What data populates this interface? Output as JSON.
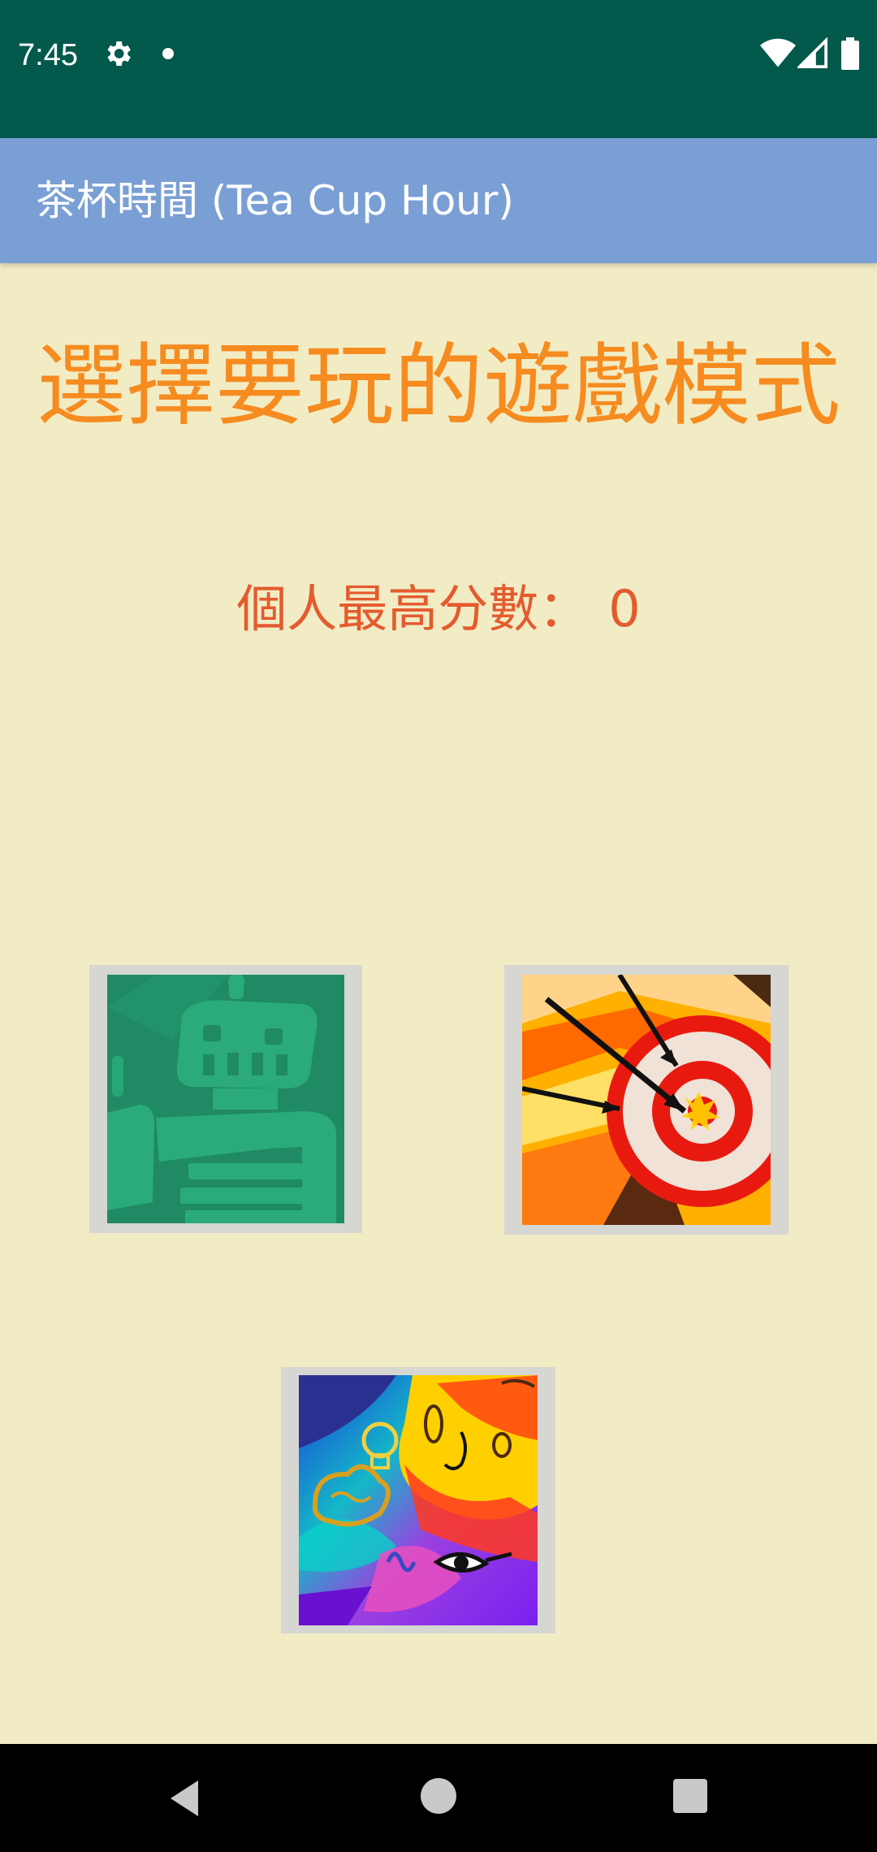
{
  "status_bar": {
    "time": "7:45",
    "icons": [
      "settings-icon",
      "notification-dot-icon",
      "wifi-icon",
      "signal-icon",
      "battery-icon"
    ]
  },
  "app_bar": {
    "title": "茶杯時間 (Tea Cup Hour)",
    "color": "#7a9fd4"
  },
  "main": {
    "heading": "選擇要玩的遊戲模式",
    "high_score_label": "個人最高分數：",
    "high_score_value": "0",
    "background": "#f2ecc5",
    "heading_color": "#f68b1f",
    "score_color": "#e35b2f"
  },
  "game_modes": [
    {
      "icon": "robot-icon"
    },
    {
      "icon": "target-icon"
    },
    {
      "icon": "mind-icon"
    }
  ],
  "nav_bar": {
    "icons": [
      "back-icon",
      "home-icon",
      "recents-icon"
    ]
  },
  "colors": {
    "status_bar": "#02594c",
    "nav_bar": "#000000"
  }
}
